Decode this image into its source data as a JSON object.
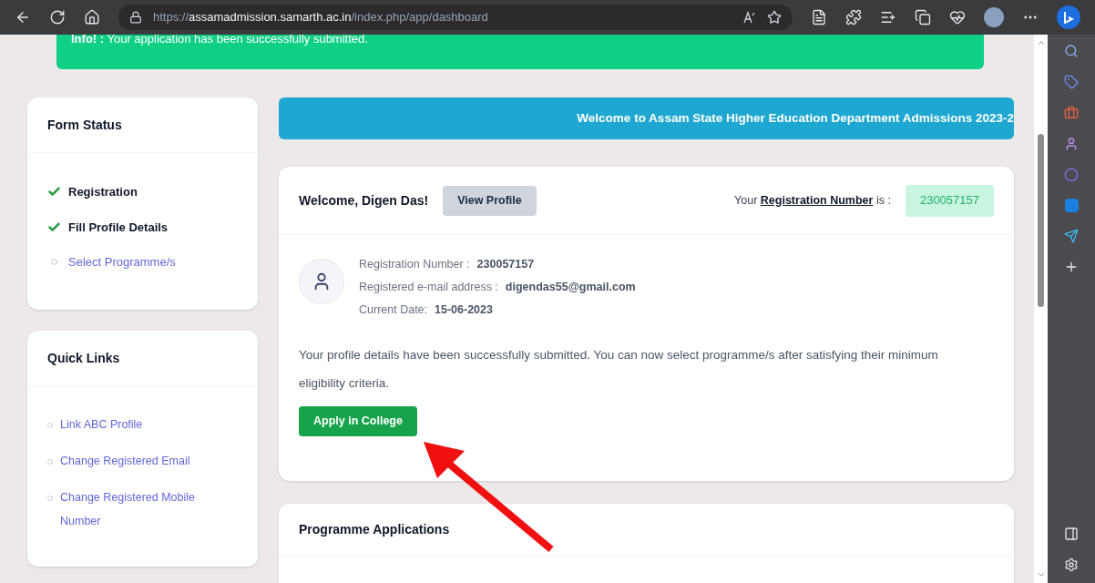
{
  "browser": {
    "url": "https://**assamadmission.samarth.ac.in**/index.php/app/dashboard"
  },
  "alert": {
    "text": "**Info! :** Your application has been successfully submitted."
  },
  "form_status": {
    "title": "Form Status",
    "items": [
      {
        "label": "Registration",
        "done": true
      },
      {
        "label": "Fill Profile Details",
        "done": true
      },
      {
        "label": "Select Programme/s",
        "done": false
      }
    ]
  },
  "quick_links": {
    "title": "Quick Links",
    "items": [
      "Link ABC Profile",
      "Change Registered Email",
      "Change Registered Mobile Number"
    ]
  },
  "banner": {
    "text": "Welcome to Assam State Higher Education Department Admissions 2023-2"
  },
  "profile_card": {
    "greeting": "Welcome, Digen Das!",
    "view_button": "View Profile",
    "reg_prefix": "Your",
    "reg_link": "Registration Number",
    "reg_suffix": "is :",
    "reg_badge": "230057157",
    "details": [
      {
        "label": "Registration Number :",
        "value": "230057157"
      },
      {
        "label": "Registered e-mail address :",
        "value": "digendas55@gmail.com"
      },
      {
        "label": "Current Date:",
        "value": "15-06-2023"
      }
    ],
    "message": "Your profile details have been successfully submitted. You can now select programme/s after satisfying their minimum eligibility criteria.",
    "apply_button": "Apply in College"
  },
  "applications": {
    "title": "Programme Applications"
  }
}
